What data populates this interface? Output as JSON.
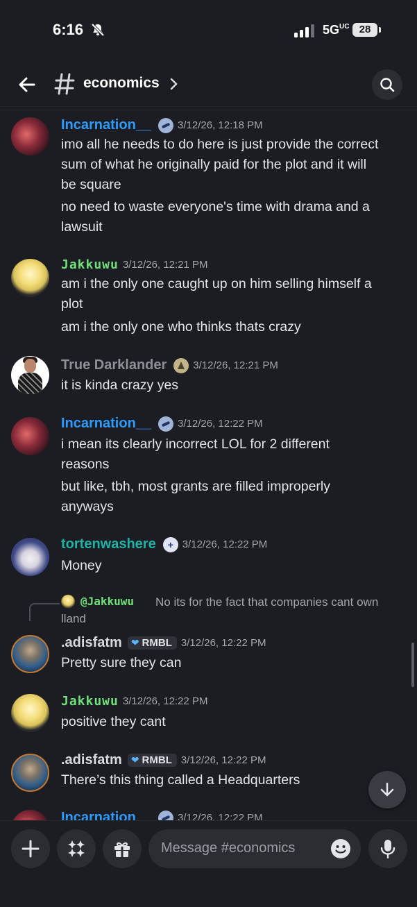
{
  "status": {
    "time": "6:16",
    "network": "5G",
    "network_badge": "UC",
    "battery": "28"
  },
  "header": {
    "channel": "economics"
  },
  "messages": [
    {
      "user": "Incarnation__",
      "timestamp": "3/12/26, 12:18 PM",
      "lines": [
        "imo all he needs to do here is just provide the correct",
        "sum of what he originally paid for the plot and it will",
        "be square",
        "no need to waste everyone's time with drama and a",
        "lawsuit"
      ]
    },
    {
      "user": "Jakkuwu",
      "timestamp": "3/12/26, 12:21 PM",
      "lines": [
        "am i the only one caught up on him selling himself a",
        "plot",
        "am i the only one who thinks thats crazy"
      ]
    },
    {
      "user": "True Darklander",
      "timestamp": "3/12/26, 12:21 PM",
      "lines": [
        "it is kinda crazy yes"
      ]
    },
    {
      "user": "Incarnation__",
      "timestamp": "3/12/26, 12:22 PM",
      "lines": [
        "i mean its clearly incorrect LOL for 2 different",
        "reasons",
        "but like, tbh, most grants are filled improperly",
        "anyways"
      ]
    },
    {
      "user": "tortenwashere",
      "timestamp": "3/12/26, 12:22 PM",
      "lines": [
        "Money"
      ]
    },
    {
      "user": ".adisfatm",
      "tag": "RMBL",
      "timestamp": "3/12/26, 12:22 PM",
      "lines": [
        "Pretty sure they can"
      ],
      "reply": {
        "user": "@Jakkuwu",
        "text_1": "No its for the fact that companies cant own",
        "text_2": "lland"
      }
    },
    {
      "user": "Jakkuwu",
      "timestamp": "3/12/26, 12:22 PM",
      "lines": [
        "positive they cant"
      ]
    },
    {
      "user": ".adisfatm",
      "tag": "RMBL",
      "timestamp": "3/12/26, 12:22 PM",
      "lines": [
        "There’s this thing called a Headquarters"
      ]
    },
    {
      "user": "Incarnation__",
      "timestamp": "3/12/26, 12:22 PM",
      "lines": []
    }
  ],
  "composer": {
    "placeholder": "Message #economics"
  }
}
